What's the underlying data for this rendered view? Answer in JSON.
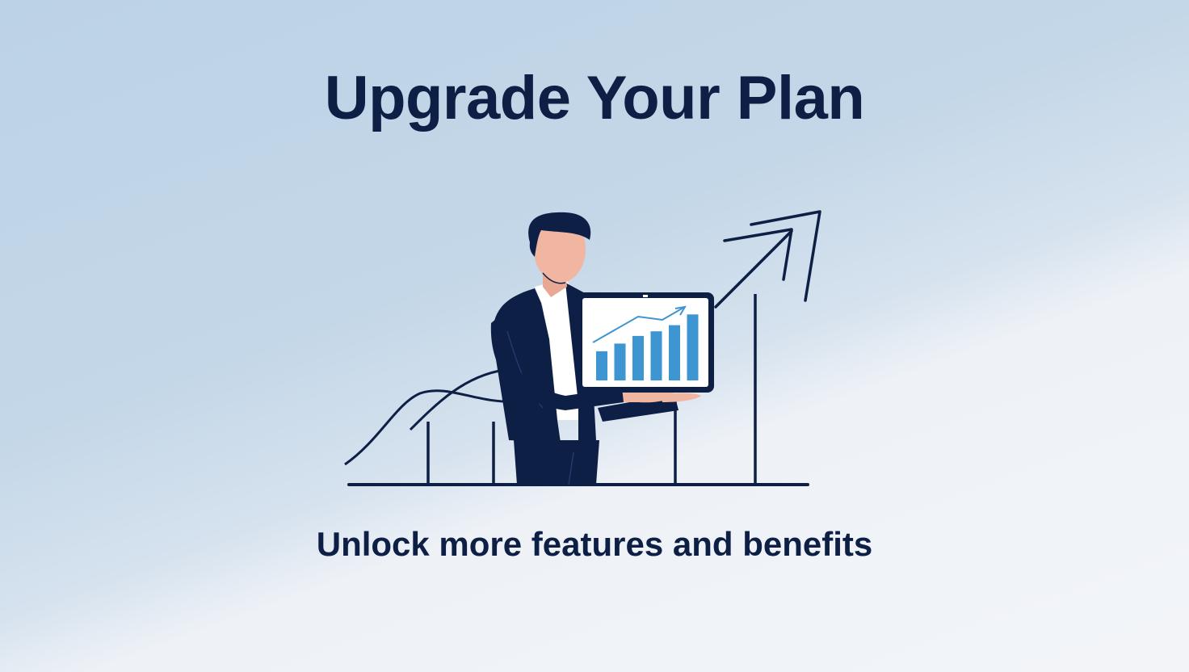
{
  "hero": {
    "title": "Upgrade Your Plan",
    "subtitle": "Unlock more features and benefits"
  },
  "colors": {
    "navy": "#0e1f45",
    "chart_blue": "#3d95d1",
    "skin": "#f0b6a2",
    "bg_top": "#bcd2e6",
    "bg_bottom": "#f2f4f8"
  },
  "illustration": {
    "subject": "businessman-holding-tablet",
    "tablet_bars": [
      0.38,
      0.48,
      0.58,
      0.64,
      0.72,
      0.86
    ]
  }
}
